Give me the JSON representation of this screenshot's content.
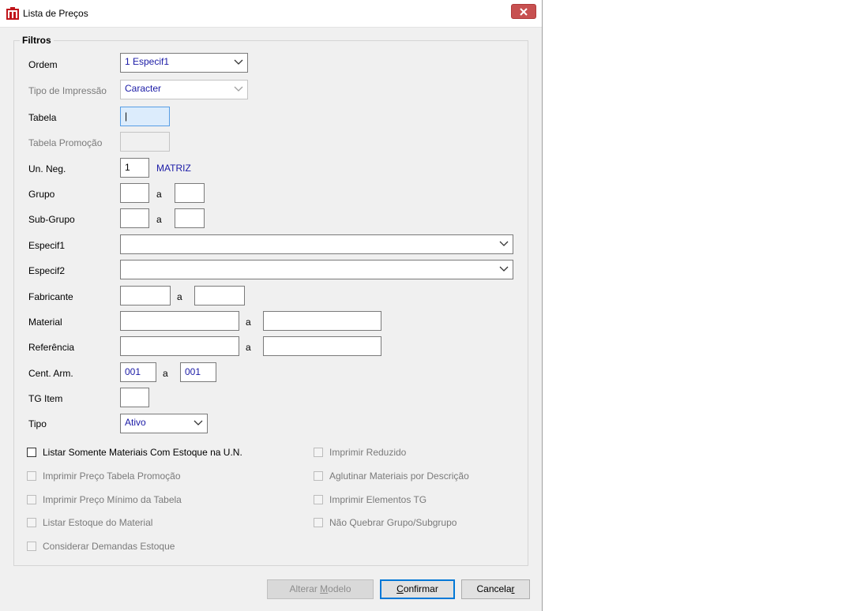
{
  "window": {
    "title": "Lista de Preços"
  },
  "filters": {
    "group_label": "Filtros",
    "ordem": {
      "label": "Ordem",
      "value": "1 Especif1"
    },
    "tipo_impressao": {
      "label": "Tipo de Impressão",
      "value": "Caracter"
    },
    "tabela": {
      "label": "Tabela",
      "value": "|"
    },
    "tabela_promocao": {
      "label": "Tabela Promoção",
      "value": ""
    },
    "un_neg": {
      "label": "Un. Neg.",
      "value": "1",
      "name": "MATRIZ"
    },
    "grupo": {
      "label": "Grupo",
      "from": "",
      "to": "",
      "sep": "a"
    },
    "sub_grupo": {
      "label": "Sub-Grupo",
      "from": "",
      "to": "",
      "sep": "a"
    },
    "especif1": {
      "label": "Especif1",
      "value": ""
    },
    "especif2": {
      "label": "Especif2",
      "value": ""
    },
    "fabricante": {
      "label": "Fabricante",
      "from": "",
      "to": "",
      "sep": "a"
    },
    "material": {
      "label": "Material",
      "from": "",
      "to": "",
      "sep": "a"
    },
    "referencia": {
      "label": "Referência",
      "from": "",
      "to": "",
      "sep": "a"
    },
    "cent_arm": {
      "label": "Cent. Arm.",
      "from": "001",
      "to": "001",
      "sep": "a"
    },
    "tg_item": {
      "label": "TG Item",
      "value": ""
    },
    "tipo": {
      "label": "Tipo",
      "value": "Ativo"
    }
  },
  "checkboxes": {
    "listar_estoque_un": "Listar Somente Materiais Com Estoque na U.N.",
    "imprimir_preco_promocao": "Imprimir Preço Tabela Promoção",
    "imprimir_preco_minimo": "Imprimir Preço Mínimo da Tabela",
    "listar_estoque_material": "Listar Estoque do Material",
    "considerar_demandas": "Considerar Demandas Estoque",
    "imprimir_reduzido": "Imprimir Reduzido",
    "aglutinar_materiais": "Aglutinar Materiais por Descrição",
    "imprimir_elementos_tg": "Imprimir Elementos TG",
    "nao_quebrar_grupo": "Não Quebrar Grupo/Subgrupo"
  },
  "buttons": {
    "alterar_modelo": {
      "pre": "Alterar ",
      "key": "M",
      "post": "odelo"
    },
    "confirmar": {
      "pre": "",
      "key": "C",
      "post": "onfirmar"
    },
    "cancelar": {
      "pre": "Cancela",
      "key": "r",
      "post": ""
    }
  },
  "colors": {
    "accent": "#0078d7",
    "value_text": "#1a1aa6",
    "close_button": "#c75050"
  }
}
